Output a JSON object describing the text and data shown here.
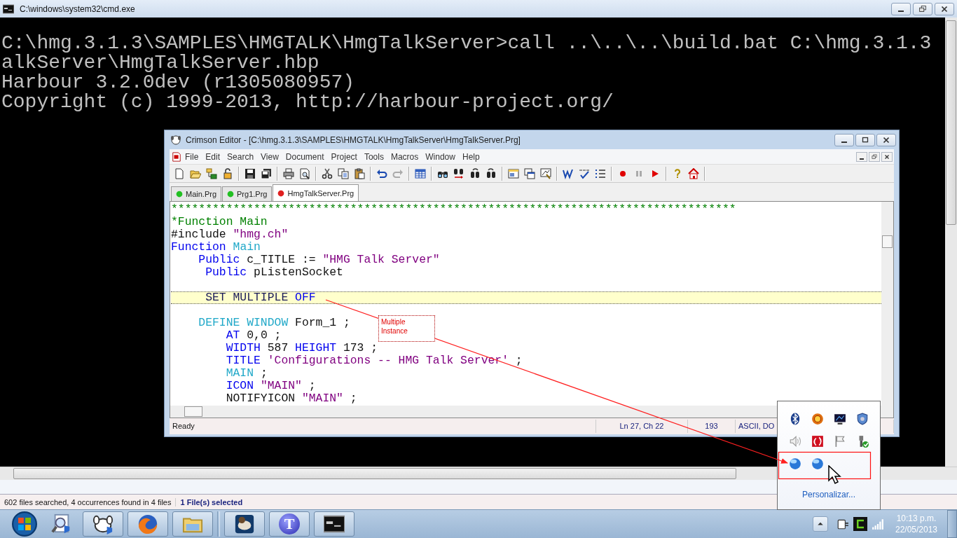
{
  "console_window": {
    "title": "C:\\windows\\system32\\cmd.exe",
    "lines": [
      "C:\\hmg.3.1.3\\SAMPLES\\HMGTALK\\HmgTalkServer>call ..\\..\\..\\build.bat C:\\hmg.3.1.3",
      "alkServer\\HmgTalkServer.hbp",
      "Harbour 3.2.0dev (r1305080957)",
      "Copyright (c) 1999-2013, http://harbour-project.org/"
    ]
  },
  "search_window": {
    "summary": "602 files searched, 4 occurrences found in 4 files",
    "selection": "1 File(s) selected"
  },
  "editor": {
    "title": "Crimson Editor - [C:\\hmg.3.1.3\\SAMPLES\\HMGTALK\\HmgTalkServer\\HmgTalkServer.Prg]",
    "menu": [
      "File",
      "Edit",
      "Search",
      "View",
      "Document",
      "Project",
      "Tools",
      "Macros",
      "Window",
      "Help"
    ],
    "tabs": [
      {
        "label": "Main.Prg",
        "selected": false,
        "color": "#22c022"
      },
      {
        "label": "Prg1.Prg",
        "selected": false,
        "color": "#22c022"
      },
      {
        "label": "HmgTalkServer.Prg",
        "selected": true,
        "color": "#e02020"
      }
    ],
    "code_lines": [
      {
        "kind": "code",
        "current": false,
        "segments": [
          {
            "text": "**********************************************************************************",
            "kind": "comment"
          }
        ]
      },
      {
        "kind": "code",
        "current": false,
        "segments": [
          {
            "text": "*Function Main",
            "kind": "comment"
          }
        ]
      },
      {
        "kind": "code",
        "current": false,
        "segments": [
          {
            "text": "#include ",
            "kind": "plain"
          },
          {
            "text": "\"hmg.ch\"",
            "kind": "string"
          }
        ]
      },
      {
        "kind": "code",
        "current": false,
        "segments": [
          {
            "text": "Function",
            "kind": "keyword"
          },
          {
            "text": " Main",
            "kind": "constant"
          }
        ]
      },
      {
        "kind": "code",
        "current": false,
        "segments": [
          {
            "text": "    Public",
            "kind": "keyword"
          },
          {
            "text": " c_TITLE := ",
            "kind": "plain"
          },
          {
            "text": "\"HMG Talk Server\"",
            "kind": "string"
          }
        ]
      },
      {
        "kind": "code",
        "current": false,
        "segments": [
          {
            "text": "     Public",
            "kind": "keyword"
          },
          {
            "text": " pListenSocket",
            "kind": "plain"
          }
        ]
      },
      {
        "kind": "blank",
        "current": false
      },
      {
        "kind": "code",
        "current": true,
        "segments": [
          {
            "text": "     SET MULTIPLE ",
            "kind": "command"
          },
          {
            "text": "OFF",
            "kind": "keyword"
          }
        ]
      },
      {
        "kind": "blank",
        "current": false
      },
      {
        "kind": "code",
        "current": false,
        "segments": [
          {
            "text": "    DEFINE WINDOW",
            "kind": "constant"
          },
          {
            "text": " Form_1 ;",
            "kind": "plain"
          }
        ]
      },
      {
        "kind": "code",
        "current": false,
        "segments": [
          {
            "text": "        AT",
            "kind": "keyword"
          },
          {
            "text": " 0,0 ;",
            "kind": "plain"
          }
        ]
      },
      {
        "kind": "code",
        "current": false,
        "segments": [
          {
            "text": "        WIDTH",
            "kind": "keyword"
          },
          {
            "text": " 587 ",
            "kind": "plain"
          },
          {
            "text": "HEIGHT",
            "kind": "keyword"
          },
          {
            "text": " 173 ;",
            "kind": "plain"
          }
        ]
      },
      {
        "kind": "code",
        "current": false,
        "segments": [
          {
            "text": "        TITLE",
            "kind": "keyword"
          },
          {
            "text": " 'Configurations -- HMG Talk Server'",
            "kind": "string"
          },
          {
            "text": " ;",
            "kind": "plain"
          }
        ]
      },
      {
        "kind": "code",
        "current": false,
        "segments": [
          {
            "text": "        MAIN",
            "kind": "constant"
          },
          {
            "text": " ;",
            "kind": "plain"
          }
        ]
      },
      {
        "kind": "code",
        "current": false,
        "segments": [
          {
            "text": "        ICON",
            "kind": "keyword"
          },
          {
            "text": " \"MAIN\"",
            "kind": "string"
          },
          {
            "text": " ;",
            "kind": "plain"
          }
        ]
      },
      {
        "kind": "code",
        "current": false,
        "segments": [
          {
            "text": "        NOTIFYICON ",
            "kind": "plain"
          },
          {
            "text": "\"MAIN\"",
            "kind": "string"
          },
          {
            "text": " ;",
            "kind": "plain"
          }
        ]
      }
    ],
    "status_bar": {
      "message": "Ready",
      "position": "Ln 27, Ch 22",
      "count": "193",
      "encoding": "ASCII, DO"
    }
  },
  "annotation": {
    "text": "Multiple Instance"
  },
  "tray_popup": {
    "link": "Personalizar..."
  },
  "taskbar": {
    "app_letter": "T",
    "clock": {
      "time": "10:13 p.m.",
      "date": "22/05/2013"
    }
  }
}
